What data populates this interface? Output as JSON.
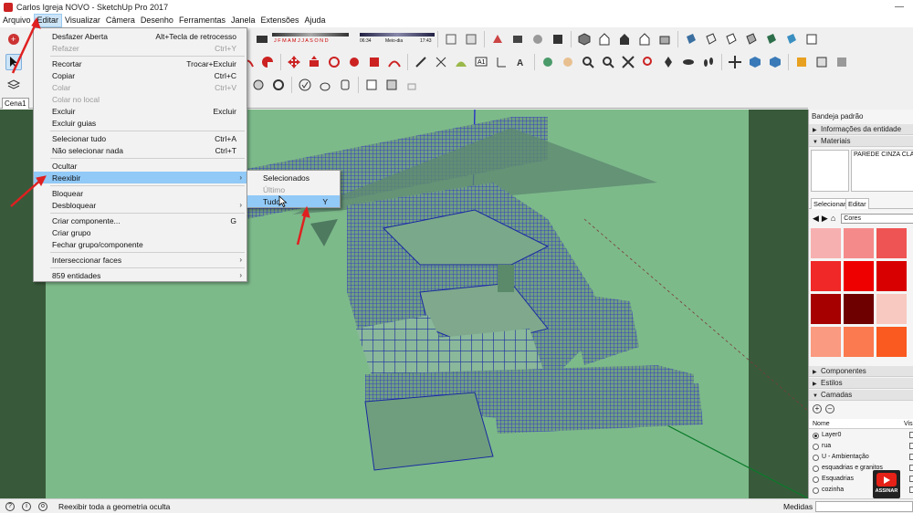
{
  "window": {
    "title": "Carlos Igreja NOVO - SketchUp Pro 2017"
  },
  "menubar": [
    "Arquivo",
    "Editar",
    "Visualizar",
    "Câmera",
    "Desenho",
    "Ferramentas",
    "Janela",
    "Extensões",
    "Ajuda"
  ],
  "active_menu": "Editar",
  "edit_menu": {
    "undo": {
      "label": "Desfazer Aberta",
      "shortcut": "Alt+Tecla de retrocesso"
    },
    "redo": {
      "label": "Refazer",
      "shortcut": "Ctrl+Y"
    },
    "cut": {
      "label": "Recortar",
      "shortcut": "Trocar+Excluir"
    },
    "copy": {
      "label": "Copiar",
      "shortcut": "Ctrl+C"
    },
    "paste": {
      "label": "Colar",
      "shortcut": "Ctrl+V"
    },
    "paste_in_place": {
      "label": "Colar no local"
    },
    "delete": {
      "label": "Excluir",
      "shortcut": "Excluir"
    },
    "delete_guides": {
      "label": "Excluir guias"
    },
    "select_all": {
      "label": "Selecionar tudo",
      "shortcut": "Ctrl+A"
    },
    "select_none": {
      "label": "Não selecionar nada",
      "shortcut": "Ctrl+T"
    },
    "hide": {
      "label": "Ocultar"
    },
    "unhide": {
      "label": "Reexibir"
    },
    "lock": {
      "label": "Bloquear"
    },
    "unlock": {
      "label": "Desbloquear"
    },
    "make_component": {
      "label": "Criar componente...",
      "shortcut": "G"
    },
    "make_group": {
      "label": "Criar grupo"
    },
    "close_group": {
      "label": "Fechar grupo/componente"
    },
    "intersect": {
      "label": "Interseccionar faces"
    },
    "entities": {
      "label": "859 entidades"
    }
  },
  "unhide_submenu": {
    "selected": {
      "label": "Selecionados"
    },
    "last": {
      "label": "Último"
    },
    "all": {
      "label": "Tudo",
      "shortcut": "Y"
    }
  },
  "shadow_toolbar": {
    "months": "J F M A M J J A S O N D",
    "time_start": "06:34",
    "midday": "Meio-dia",
    "time_end": "17:43"
  },
  "scenes": {
    "tab1": "Cena1"
  },
  "tray": {
    "title": "Bandeja padrão",
    "entity_info": "Informações da entidade",
    "materials": "Materiais",
    "material_name": "PAREDE CINZA CLARO",
    "tab_select": "Selecionar",
    "tab_edit": "Editar",
    "library": "Cores",
    "swatches": [
      "#f7b0b0",
      "#f58a8a",
      "#ef5454",
      "#f02828",
      "#ee0000",
      "#d80000",
      "#a60000",
      "#6e0000",
      "#f8c9c0",
      "#fa9a80",
      "#fb7a50",
      "#fa5a20"
    ],
    "components": "Componentes",
    "styles": "Estilos",
    "layers": "Camadas",
    "layer_col_name": "Nome",
    "layer_col_visible": "Visí",
    "layer_list": [
      "Layer0",
      "rua",
      "U - Ambientação",
      "esquadrias e granitos",
      "Esquadrias",
      "cozinha"
    ]
  },
  "badge": {
    "label": "ASSINAR"
  },
  "status": {
    "message": "Reexibir toda a geometria oculta",
    "measures_label": "Medidas"
  }
}
